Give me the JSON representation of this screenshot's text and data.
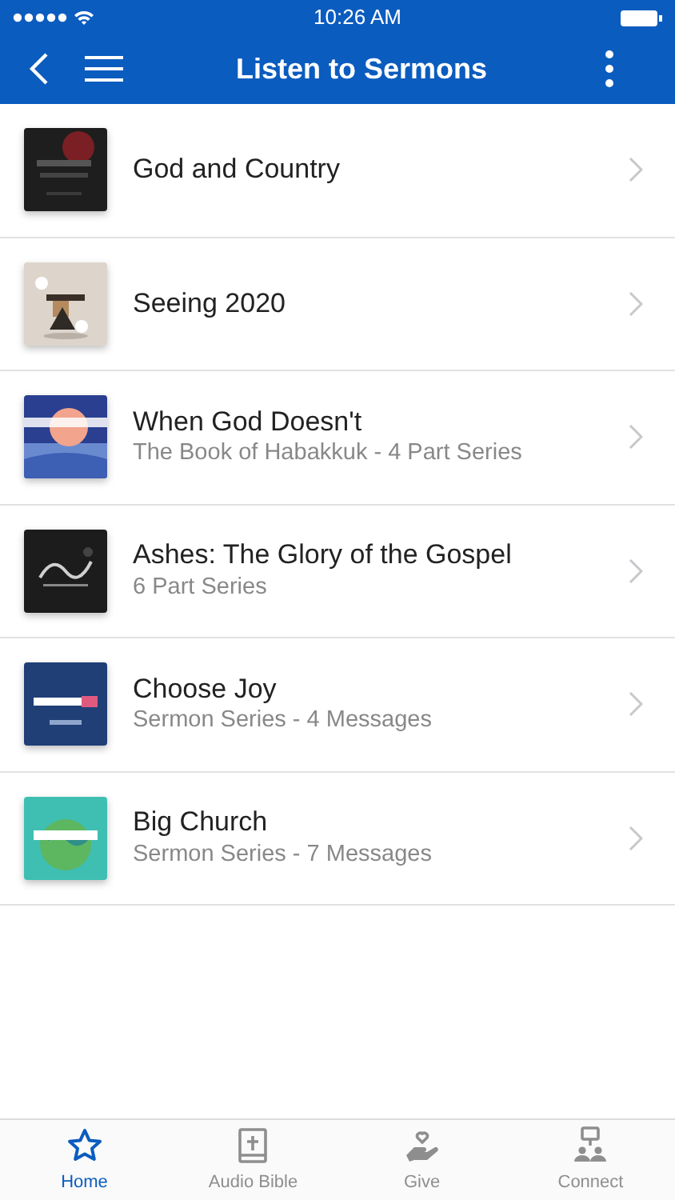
{
  "status_bar": {
    "time": "10:26 AM"
  },
  "nav_bar": {
    "title": "Listen to Sermons"
  },
  "sermons": [
    {
      "title": "God and Country"
    },
    {
      "title": "Seeing 2020"
    },
    {
      "title": "When God Doesn't",
      "subtitle": "The Book of Habakkuk - 4 Part Series"
    },
    {
      "title": "Ashes: The Glory of the Gospel",
      "subtitle": "6 Part Series"
    },
    {
      "title": "Choose Joy",
      "subtitle": "Sermon Series - 4 Messages"
    },
    {
      "title": "Big Church",
      "subtitle": "Sermon Series - 7 Messages"
    }
  ],
  "tab_bar": [
    {
      "label": "Home",
      "kind": "star",
      "selected": true
    },
    {
      "label": "Audio Bible",
      "kind": "bible",
      "selected": false
    },
    {
      "label": "Give",
      "kind": "give",
      "selected": false
    },
    {
      "label": "Connect",
      "kind": "connect",
      "selected": false
    }
  ]
}
